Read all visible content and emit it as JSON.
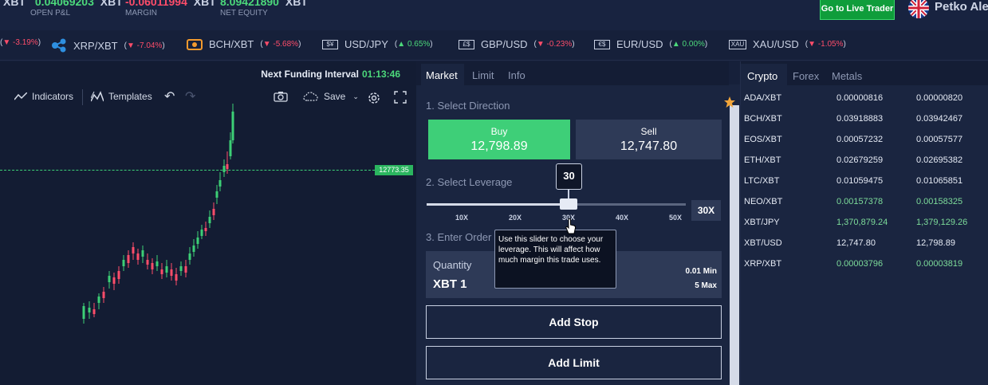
{
  "topbar": {
    "stats": [
      {
        "prefix": "XBT",
        "value": "0.04069203",
        "unit": "XBT",
        "label": "OPEN P&L",
        "color": "green"
      },
      {
        "prefix": "",
        "value": "-0.06011994",
        "unit": "XBT",
        "label": "MARGIN",
        "color": "red"
      },
      {
        "prefix": "",
        "value": "8.09421890",
        "unit": "XBT",
        "label": "NET EQUITY",
        "color": "green"
      }
    ],
    "live_button": "Go to Live Trader",
    "user_name": "Petko Ale"
  },
  "ticker": [
    {
      "symbol": "",
      "change": "3.19%",
      "direction": "down",
      "icon": "partial"
    },
    {
      "symbol": "XRP/XBT",
      "change": "-7.04%",
      "direction": "down",
      "icon": "xrp-icon"
    },
    {
      "symbol": "BCH/XBT",
      "change": "-5.68%",
      "direction": "down",
      "icon": "bch-icon"
    },
    {
      "symbol": "USD/JPY",
      "change": "0.65%",
      "direction": "up",
      "icon": "$¥"
    },
    {
      "symbol": "GBP/USD",
      "change": "-0.23%",
      "direction": "down",
      "icon": "£$"
    },
    {
      "symbol": "EUR/USD",
      "change": "0.00%",
      "direction": "up",
      "icon": "€$"
    },
    {
      "symbol": "XAU/USD",
      "change": "-1.05%",
      "direction": "down",
      "icon": "XAU"
    }
  ],
  "chart": {
    "funding_label": "Next Funding Interval",
    "funding_time": "01:13:46",
    "indicators": "Indicators",
    "templates": "Templates",
    "save": "Save",
    "price_tag": "12773.35"
  },
  "order": {
    "tabs": [
      "Market",
      "Limit",
      "Info"
    ],
    "section1": "1. Select Direction",
    "buy_label": "Buy",
    "buy_price": "12,798.89",
    "sell_label": "Sell",
    "sell_price": "12,747.80",
    "section2": "2. Select Leverage",
    "leverage_bubble": "30",
    "leverage_ticks": [
      "10X",
      "20X",
      "30X",
      "40X",
      "50X"
    ],
    "leverage_value": "30X",
    "section3": "3. Enter Order",
    "quantity_label": "Quantity",
    "quantity_value": "XBT  1",
    "quantity_min": "0.01 Min",
    "quantity_max": "5 Max",
    "add_stop": "Add Stop",
    "add_limit": "Add Limit",
    "tooltip": "Use this slider to choose your leverage. This will affect how much margin this trade uses."
  },
  "prices": {
    "tabs": [
      "Crypto",
      "Forex",
      "Metals"
    ],
    "rows": [
      {
        "symbol": "ADA/XBT",
        "bid": "0.00000816",
        "ask": "0.00000820",
        "color": "white"
      },
      {
        "symbol": "BCH/XBT",
        "bid": "0.03918883",
        "ask": "0.03942467",
        "color": "white"
      },
      {
        "symbol": "EOS/XBT",
        "bid": "0.00057232",
        "ask": "0.00057577",
        "color": "white"
      },
      {
        "symbol": "ETH/XBT",
        "bid": "0.02679259",
        "ask": "0.02695382",
        "color": "white"
      },
      {
        "symbol": "LTC/XBT",
        "bid": "0.01059475",
        "ask": "0.01065851",
        "color": "white"
      },
      {
        "symbol": "NEO/XBT",
        "bid": "0.00157378",
        "ask": "0.00158325",
        "color": "green"
      },
      {
        "symbol": "XBT/JPY",
        "bid": "1,370,879.24",
        "ask": "1,379,129.26",
        "color": "green"
      },
      {
        "symbol": "XBT/USD",
        "bid": "12,747.80",
        "ask": "12,798.89",
        "color": "white"
      },
      {
        "symbol": "XRP/XBT",
        "bid": "0.00003796",
        "ask": "0.00003819",
        "color": "green"
      }
    ]
  }
}
